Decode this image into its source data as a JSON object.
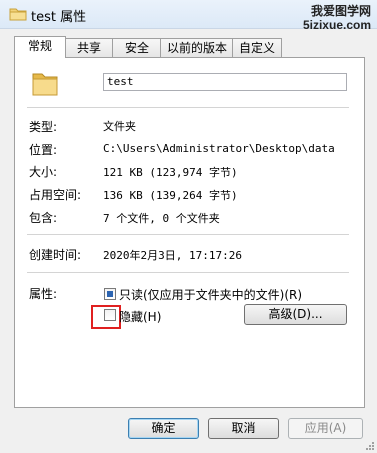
{
  "window": {
    "title": "test 属性"
  },
  "watermark": {
    "line1": "我爱图学网",
    "line2": "5izixue.com"
  },
  "tabs": [
    {
      "label": "常规"
    },
    {
      "label": "共享"
    },
    {
      "label": "安全"
    },
    {
      "label": "以前的版本"
    },
    {
      "label": "自定义"
    }
  ],
  "general": {
    "name": "test",
    "type_label": "类型:",
    "type_value": "文件夹",
    "location_label": "位置:",
    "location_value": "C:\\Users\\Administrator\\Desktop\\data",
    "size_label": "大小:",
    "size_value": "121 KB (123,974 字节)",
    "disk_label": "占用空间:",
    "disk_value": "136 KB (139,264 字节)",
    "contains_label": "包含:",
    "contains_value": "7 个文件, 0 个文件夹",
    "created_label": "创建时间:",
    "created_value": "2020年2月3日, 17:17:26",
    "attributes_label": "属性:",
    "readonly_label": "只读(仅应用于文件夹中的文件)(R)",
    "readonly_checked": true,
    "hidden_label": "隐藏(H)",
    "hidden_checked": false,
    "advanced_label": "高级(D)..."
  },
  "buttons": {
    "ok": "确定",
    "cancel": "取消",
    "apply": "应用(A)"
  },
  "colors": {
    "highlight": "#e02020",
    "checkbox_fill": "#2c64b1"
  }
}
